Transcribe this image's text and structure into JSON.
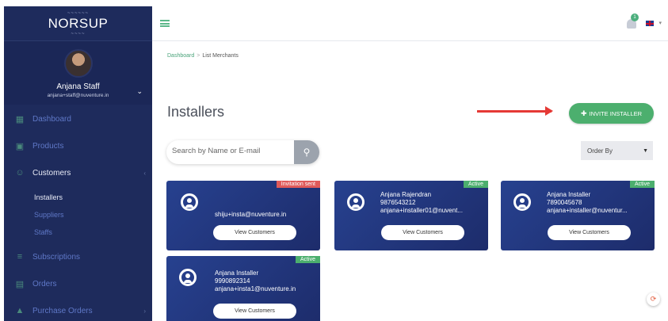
{
  "brand": {
    "wave": "~~~~~~",
    "name": "NORSUP",
    "sub": "~~~~"
  },
  "profile": {
    "name": "Anjana Staff",
    "email": "anjana+staff@nuventure.in"
  },
  "nav": [
    {
      "label": "Dashboard",
      "icon": "dashboard-icon"
    },
    {
      "label": "Products",
      "icon": "cart-icon"
    },
    {
      "label": "Customers",
      "icon": "users-icon"
    },
    {
      "label": "Subscriptions",
      "icon": "list-icon"
    },
    {
      "label": "Orders",
      "icon": "orders-icon"
    },
    {
      "label": "Purchase Orders",
      "icon": "basket-icon"
    }
  ],
  "subnav": [
    "Installers",
    "Suppliers",
    "Staffs"
  ],
  "topbar": {
    "notifications": "1"
  },
  "breadcrumb": {
    "home": "Dashboard",
    "separator": ">",
    "current": "List Merchants"
  },
  "page": {
    "title": "Installers",
    "invite_label": "INVITE INSTALLER"
  },
  "search": {
    "placeholder": "Search by Name or E-mail"
  },
  "order_by": {
    "label": "Order By"
  },
  "colors": {
    "sidebar": "#1e2b5c",
    "accent": "#4caf6e",
    "card": "#27418f",
    "status_active": "#4caf6e",
    "status_invited": "#e05a5a"
  },
  "cards": [
    {
      "status": "Invitation sent",
      "name": "",
      "phone": "",
      "email": "shiju+insta@nuventure.in",
      "button": "View Customers"
    },
    {
      "status": "Active",
      "name": "Anjana Rajendran",
      "phone": "9876543212",
      "email": "anjana+installer01@nuvent...",
      "button": "View Customers"
    },
    {
      "status": "Active",
      "name": "Anjana Installer",
      "phone": "7890045678",
      "email": "anjana+installer@nuventur...",
      "button": "View Customers"
    },
    {
      "status": "Active",
      "name": "Anjana Installer",
      "phone": "9990892314",
      "email": "anjana+insta1@nuventure.in",
      "button": "View Customers"
    }
  ]
}
